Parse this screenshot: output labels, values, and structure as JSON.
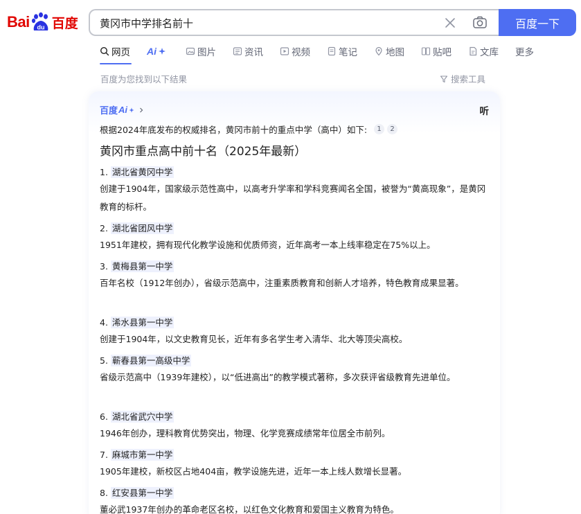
{
  "logo": {
    "bai": "Bai",
    "du": "du",
    "cn": "百度"
  },
  "search": {
    "query": "黄冈市中学排名前十",
    "button": "百度一下"
  },
  "tabs": [
    {
      "label": "网页",
      "icon": "search-icon"
    },
    {
      "label": "Ai",
      "icon": "ai-sparkle-icon"
    },
    {
      "label": "图片",
      "icon": "image-icon"
    },
    {
      "label": "资讯",
      "icon": "news-icon"
    },
    {
      "label": "视频",
      "icon": "video-icon"
    },
    {
      "label": "笔记",
      "icon": "note-icon"
    },
    {
      "label": "地图",
      "icon": "map-icon"
    },
    {
      "label": "贴吧",
      "icon": "tieba-icon"
    },
    {
      "label": "文库",
      "icon": "wenku-icon"
    },
    {
      "label": "更多",
      "icon": ""
    }
  ],
  "result_tip": "百度为您找到以下结果",
  "tools": "搜索工具",
  "ai_card": {
    "brand": "百度",
    "brand_ai": "Ai",
    "listen": "听",
    "intro": "根据2024年底发布的权威排名，黄冈市前十的重点中学（高中）如下:",
    "citations": [
      "1",
      "2"
    ],
    "title": "黄冈市重点高中前十名（2025年最新）",
    "items": [
      {
        "num": "1.",
        "name": "湖北省黄冈中学",
        "desc": "创建于1904年，国家级示范性高中，以高考升学率和学科竞赛闻名全国，被誉为“黄高现象”，是黄冈教育的标杆。"
      },
      {
        "num": "2.",
        "name": "湖北省团风中学",
        "desc": "1951年建校，拥有现代化教学设施和优质师资，近年高考一本上线率稳定在75%以上。"
      },
      {
        "num": "3.",
        "name": "黄梅县第一中学",
        "desc": "百年名校（1912年创办），省级示范高中，注重素质教育和创新人才培养，特色教育成果显著。"
      },
      {
        "num": "4.",
        "name": "浠水县第一中学",
        "desc": "创建于1904年，以文史教育见长，近年有多名学生考入清华、北大等顶尖高校。"
      },
      {
        "num": "5.",
        "name": "蕲春县第一高级中学",
        "desc": "省级示范高中（1939年建校），以“低进高出”的教学模式著称，多次获评省级教育先进单位。"
      },
      {
        "num": "6.",
        "name": "湖北省武穴中学",
        "desc": "1946年创办，理科教育优势突出，物理、化学竞赛成绩常年位居全市前列。"
      },
      {
        "num": "7.",
        "name": "麻城市第一中学",
        "desc": "1905年建校，新校区占地404亩，教学设施先进，近年一本上线人数增长显著。"
      },
      {
        "num": "8.",
        "name": "红安县第一中学",
        "desc": "董必武1937年创办的革命老区名校，以红色文化教育和爱国主义教育为特色。"
      }
    ]
  },
  "colors": {
    "brand_red": "#e10602",
    "accent_blue": "#4e6ef2"
  }
}
